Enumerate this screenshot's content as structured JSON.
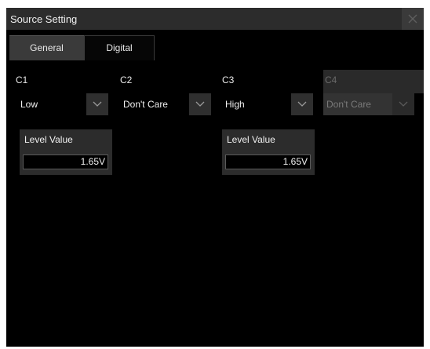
{
  "dialog": {
    "title": "Source Setting",
    "close_icon": "close-icon"
  },
  "tabs": [
    {
      "label": "General",
      "active": true
    },
    {
      "label": "Digital",
      "active": false
    }
  ],
  "channels": [
    {
      "label": "C1",
      "value": "Low",
      "enabled": true,
      "level_label": "Level Value",
      "level_value": "1.65V"
    },
    {
      "label": "C2",
      "value": "Don't Care",
      "enabled": true
    },
    {
      "label": "C3",
      "value": "High",
      "enabled": true,
      "level_label": "Level Value",
      "level_value": "1.65V"
    },
    {
      "label": "C4",
      "value": "Don't Care",
      "enabled": false
    }
  ],
  "icons": {
    "dropdown": "chevron-down-icon"
  },
  "colors": {
    "background": "#000000",
    "panel": "#2c2c2c",
    "text": "#f0f0f0",
    "disabled_text": "#6a6a6a"
  }
}
